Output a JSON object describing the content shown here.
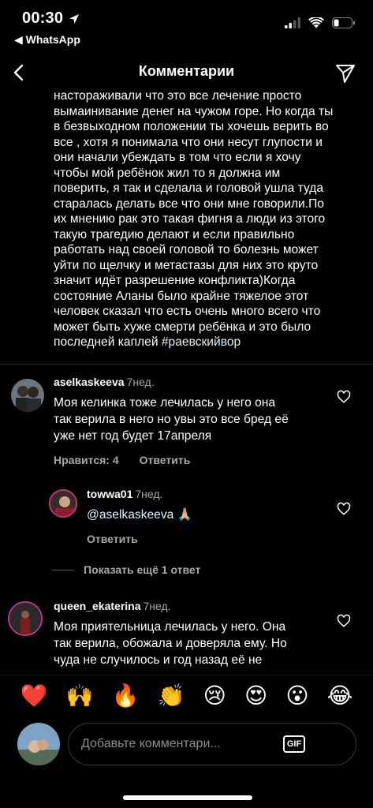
{
  "status_bar": {
    "time": "00:30",
    "back_app": "◀ WhatsApp"
  },
  "header": {
    "title": "Комментарии"
  },
  "caption": {
    "lines": [
      "настораживали что это все лечение просто",
      "вымаинивание денег на чужом горе. Но когда ты",
      "в безвыходном положении ты хочешь верить во",
      "все , хотя я понимала что они несут глупости и",
      "они  начали убеждать в том что если я хочу",
      "чтобы мой ребёнок жил то я должна им",
      "поверить, я так и сделала и головой ушла туда",
      "старалась делать  все что они мне говорили.По",
      "их мнению рак это такая фигня а люди из этого",
      "такую трагедию делают и если правильно",
      "работать над своей головой то болезнь может",
      "уйти по щелчку и метастазы для них это круто",
      "значит идёт разрешение конфликта)Когда",
      "состояние Аланы было крайне тяжелое этот",
      "человек сказал что есть очень много всего что",
      "может быть хуже смерти ребёнка и это было"
    ],
    "last_line": "последней каплей ",
    "hashtag": "#раевскийвор"
  },
  "comments": [
    {
      "username": "aselkaskeeva",
      "time": "7нед.",
      "text_lines": [
        "Моя келинка тоже лечилась у него она",
        "так верила в него но увы это все бред её",
        "уже нет год будет 17апреля"
      ],
      "likes": "Нравится: 4",
      "reply": "Ответить"
    },
    {
      "username": "towwa01",
      "time": "7нед.",
      "mention": "@aselkaskeeva",
      "emoji": "🙏🏼",
      "reply": "Ответить"
    },
    {
      "username": "queen_ekaterina",
      "time": "7нед.",
      "text_lines": [
        "Моя приятельница лечилась у него. Она",
        "так верила, обожала и доверяла ему. Но",
        "чуда не случилось и год назад её не"
      ]
    }
  ],
  "more_replies": "Показать ещё 1 ответ",
  "emoji_bar": [
    "❤️",
    "🙌",
    "🔥",
    "👏",
    "😢",
    "😍",
    "😮",
    "😂"
  ],
  "input": {
    "placeholder": "Добавьте комментари...",
    "gif_label": "GIF"
  },
  "colors": {
    "background": "#000000",
    "secondary_text": "#a8a8a8",
    "mention": "#e0f1ff"
  }
}
